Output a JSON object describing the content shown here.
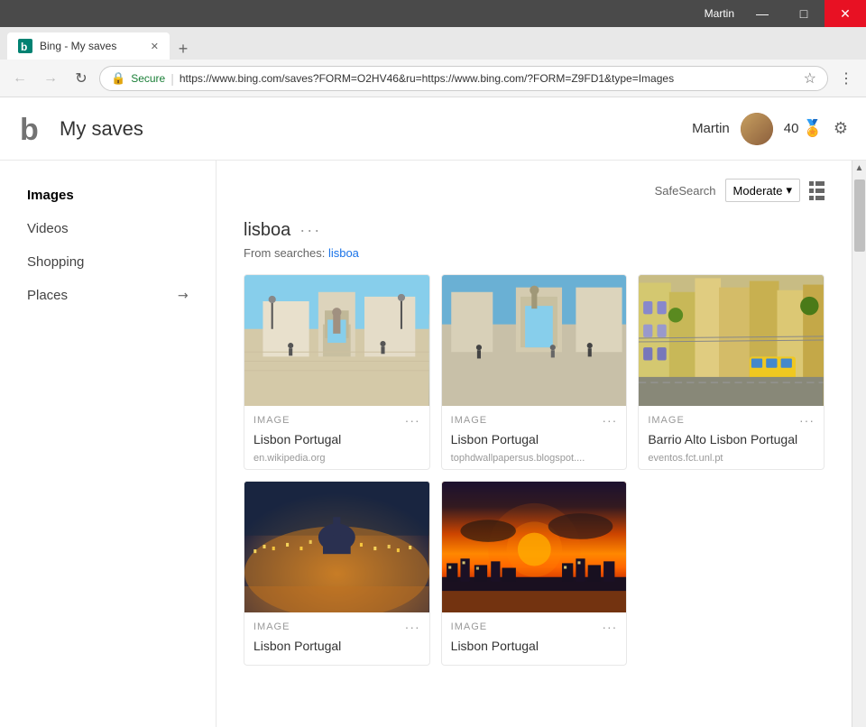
{
  "titlebar": {
    "user_label": "Martin",
    "minimize_label": "—",
    "maximize_label": "□",
    "close_label": "✕"
  },
  "tabbar": {
    "tab_title": "Bing - My saves",
    "new_tab_label": "+"
  },
  "addressbar": {
    "back_icon": "←",
    "forward_icon": "→",
    "refresh_icon": "↻",
    "secure_label": "Secure",
    "url": "https://www.bing.com/saves?FORM=O2HV46&ru=https://www.bing.com/?FORM=Z9FD1&type=Images",
    "menu_icon": "⋮"
  },
  "header": {
    "logo_letter": "b",
    "title": "My saves",
    "user_name": "Martin",
    "score": "40",
    "medal_icon": "🏅"
  },
  "sidebar": {
    "items": [
      {
        "label": "Images",
        "active": true,
        "arrow": false
      },
      {
        "label": "Videos",
        "active": false,
        "arrow": false
      },
      {
        "label": "Shopping",
        "active": false,
        "arrow": false
      },
      {
        "label": "Places",
        "active": false,
        "arrow": true
      }
    ]
  },
  "toolbar": {
    "safesearch_label": "SafeSearch",
    "safesearch_value": "Moderate",
    "dropdown_arrow": "▾"
  },
  "collection": {
    "name": "lisboa",
    "more_icon": "···",
    "from_searches_label": "From searches:",
    "from_searches_link": "lisboa"
  },
  "image_cards": [
    {
      "type": "IMAGE",
      "title": "Lisbon Portugal",
      "source": "en.wikipedia.org",
      "img_class": "img-lisbon1"
    },
    {
      "type": "IMAGE",
      "title": "Lisbon Portugal",
      "source": "tophdwallpapersus.blogspot....",
      "img_class": "img-lisbon2"
    },
    {
      "type": "IMAGE",
      "title": "Barrio Alto Lisbon Portugal",
      "source": "eventos.fct.unl.pt",
      "img_class": "img-lisbon3"
    },
    {
      "type": "IMAGE",
      "title": "Lisbon Portugal",
      "source": "",
      "img_class": "img-lisbon4"
    },
    {
      "type": "IMAGE",
      "title": "Lisbon Portugal",
      "source": "",
      "img_class": "img-lisbon5"
    }
  ],
  "more_dots": "···"
}
